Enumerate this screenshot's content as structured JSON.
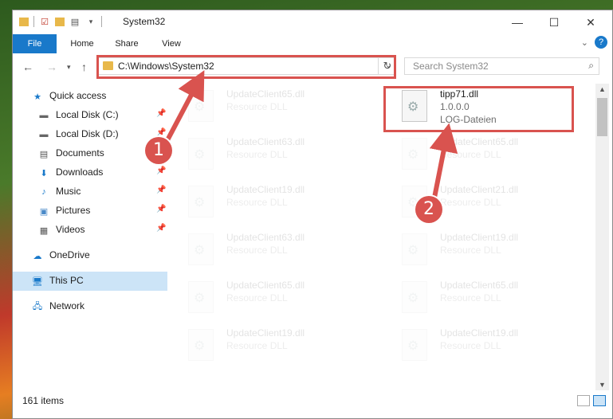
{
  "window": {
    "title": "System32"
  },
  "ribbon": {
    "tabs": [
      "File",
      "Home",
      "Share",
      "View"
    ]
  },
  "address": {
    "path": "C:\\Windows\\System32"
  },
  "search": {
    "placeholder": "Search System32"
  },
  "sidebar": {
    "items": [
      {
        "label": "Quick access",
        "icon": "star-icon",
        "pinned": false
      },
      {
        "label": "Local Disk (C:)",
        "icon": "drive-icon",
        "pinned": true
      },
      {
        "label": "Local Disk (D:)",
        "icon": "drive-icon",
        "pinned": true
      },
      {
        "label": "Documents",
        "icon": "documents-icon",
        "pinned": true
      },
      {
        "label": "Downloads",
        "icon": "download-icon",
        "pinned": true
      },
      {
        "label": "Music",
        "icon": "music-icon",
        "pinned": true
      },
      {
        "label": "Pictures",
        "icon": "pictures-icon",
        "pinned": true
      },
      {
        "label": "Videos",
        "icon": "videos-icon",
        "pinned": true
      },
      {
        "label": "OneDrive",
        "icon": "cloud-icon",
        "pinned": false
      },
      {
        "label": "This PC",
        "icon": "computer-icon",
        "pinned": false,
        "selected": true
      },
      {
        "label": "Network",
        "icon": "network-icon",
        "pinned": false
      }
    ]
  },
  "files": {
    "highlighted": {
      "name": "tipp71.dll",
      "version": "1.0.0.0",
      "type": "LOG-Dateien"
    },
    "left_column": [
      {
        "name": "UpdateClient65.dll",
        "type": "Resource DLL"
      },
      {
        "name": "UpdateClient63.dll",
        "type": "Resource DLL"
      },
      {
        "name": "UpdateClient19.dll",
        "type": "Resource DLL"
      },
      {
        "name": "UpdateClient63.dll",
        "type": "Resource DLL"
      },
      {
        "name": "UpdateClient65.dll",
        "type": "Resource DLL"
      },
      {
        "name": "UpdateClient19.dll",
        "type": "Resource DLL"
      }
    ],
    "right_column": [
      {
        "name": "UpdateClient65.dll",
        "type": "Resource DLL"
      },
      {
        "name": "UpdateClient21.dll",
        "type": "Resource DLL"
      },
      {
        "name": "UpdateClient19.dll",
        "type": "Resource DLL"
      },
      {
        "name": "UpdateClient65.dll",
        "type": "Resource DLL"
      },
      {
        "name": "UpdateClient19.dll",
        "type": "Resource DLL"
      }
    ]
  },
  "status": {
    "item_count": "161 items"
  },
  "annotations": {
    "badge1": "1",
    "badge2": "2",
    "color": "#d9534f"
  }
}
